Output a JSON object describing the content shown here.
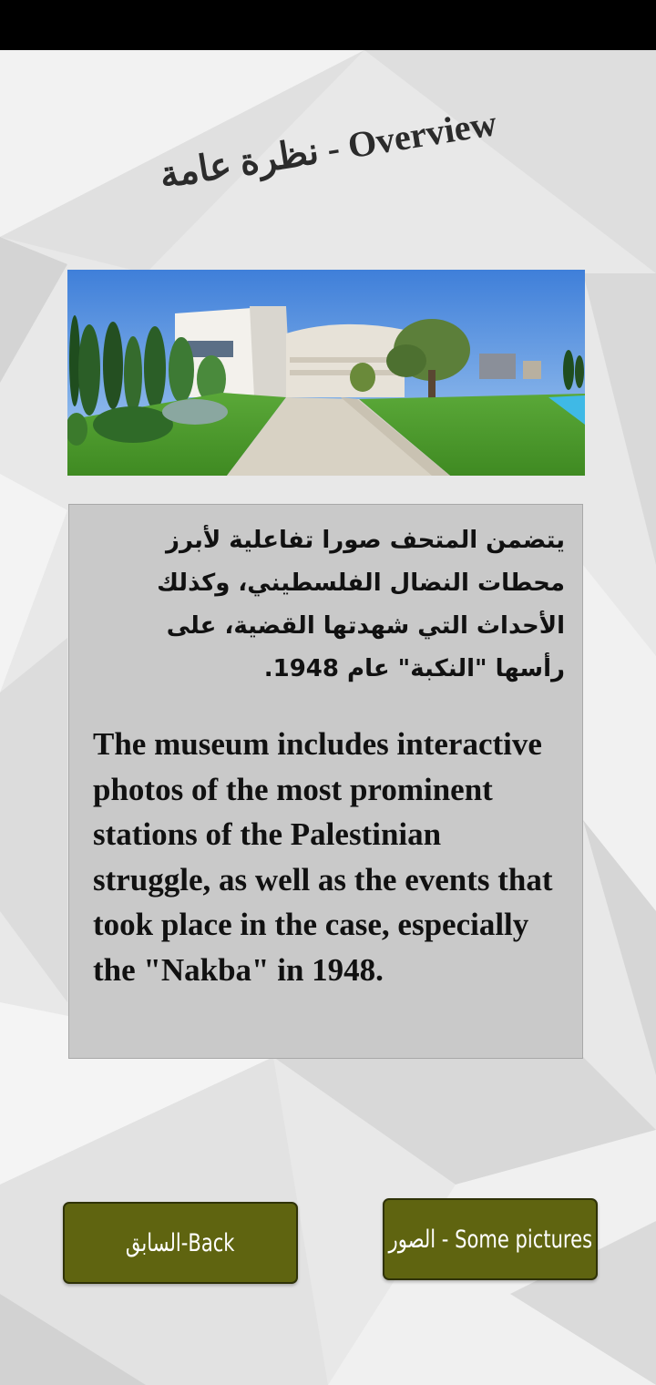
{
  "status_bar": {},
  "page": {
    "title": "نظرة عامة - Overview"
  },
  "hero_image": {
    "description": "museum-building-photo"
  },
  "description": {
    "arabic": "يتضمن المتحف صورا تفاعلية لأبرز محطات النضال الفلسطيني، وكذلك الأحداث التي شهدتها القضية، على رأسها \"النكبة\" عام 1948.",
    "english": "The museum includes interactive photos of the most prominent stations of the Palestinian struggle, as well as the events that took place in the case, especially the \"Nakba\" in 1948."
  },
  "buttons": {
    "back_label": "السابق-Back",
    "pictures_label": "الصور - Some pictures"
  },
  "colors": {
    "button_bg": "#5f6410",
    "box_bg": "#c9c9c9",
    "page_bg": "#e6e6e6"
  }
}
